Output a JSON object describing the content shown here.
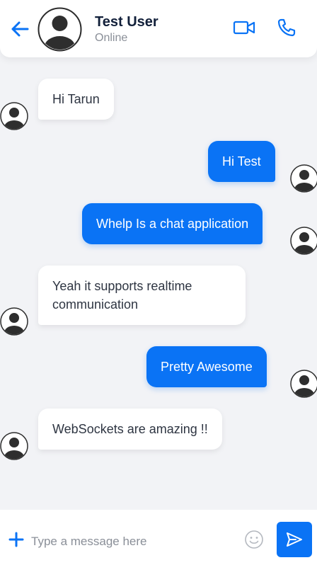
{
  "header": {
    "name": "Test User",
    "status": "Online",
    "icons": {
      "back": "arrow-left-icon",
      "video": "video-call-icon",
      "phone": "phone-call-icon"
    }
  },
  "messages": [
    {
      "direction": "incoming",
      "text": "Hi Tarun"
    },
    {
      "direction": "outgoing",
      "text": "Hi Test"
    },
    {
      "direction": "outgoing",
      "text": "Whelp Is a chat application"
    },
    {
      "direction": "incoming",
      "text": "Yeah it supports realtime communication"
    },
    {
      "direction": "outgoing",
      "text": "Pretty Awesome"
    },
    {
      "direction": "incoming",
      "text": "WebSockets are amazing !!"
    }
  ],
  "composer": {
    "placeholder": "Type a message here",
    "value": "",
    "icons": {
      "attach": "plus-icon",
      "emoji": "emoji-icon",
      "send": "send-icon"
    }
  },
  "colors": {
    "accent": "#0a73f5",
    "background": "#f2f3f6",
    "incoming_bubble": "#ffffff",
    "outgoing_text": "#ffffff"
  }
}
